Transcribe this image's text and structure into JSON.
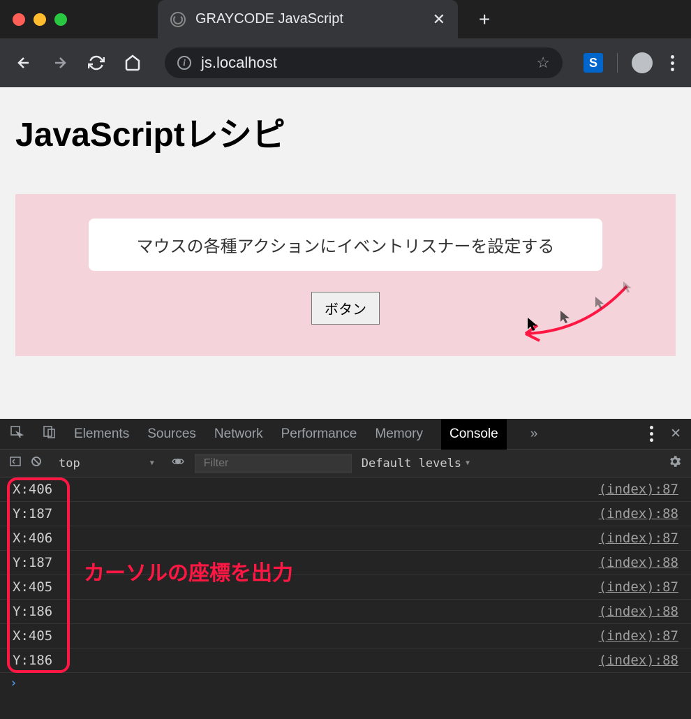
{
  "browser": {
    "tab_title": "GRAYCODE JavaScript",
    "url": "js.localhost",
    "new_tab_glyph": "+",
    "close_glyph": "✕",
    "star_glyph": "☆",
    "ext_letter": "S"
  },
  "page": {
    "title": "JavaScriptレシピ",
    "panel_text": "マウスの各種アクションにイベントリスナーを設定する",
    "button_label": "ボタン"
  },
  "devtools": {
    "tabs": {
      "elements": "Elements",
      "sources": "Sources",
      "network": "Network",
      "performance": "Performance",
      "memory": "Memory",
      "console": "Console"
    },
    "more_glyph": "»",
    "close_glyph": "✕",
    "context": "top",
    "filter_placeholder": "Filter",
    "levels": "Default levels",
    "rows": [
      {
        "msg": "X:406",
        "src": "(index):87"
      },
      {
        "msg": "Y:187",
        "src": "(index):88"
      },
      {
        "msg": "X:406",
        "src": "(index):87"
      },
      {
        "msg": "Y:187",
        "src": "(index):88"
      },
      {
        "msg": "X:405",
        "src": "(index):87"
      },
      {
        "msg": "Y:186",
        "src": "(index):88"
      },
      {
        "msg": "X:405",
        "src": "(index):87"
      },
      {
        "msg": "Y:186",
        "src": "(index):88"
      }
    ],
    "annotation": "カーソルの座標を出力",
    "prompt_glyph": "›"
  }
}
